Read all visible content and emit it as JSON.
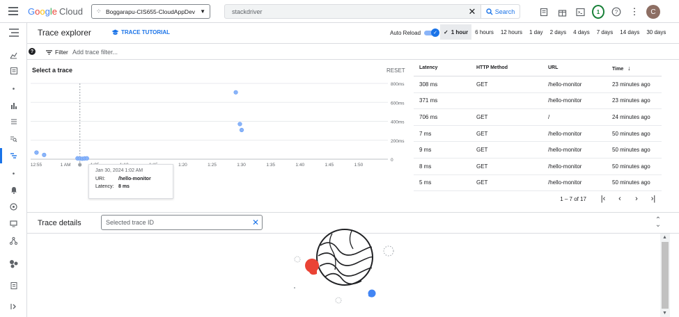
{
  "topbar": {
    "brand": [
      "G",
      "o",
      "o",
      "g",
      "l",
      "e"
    ],
    "brand_suffix": "Cloud",
    "project": "Boggarapu-CIS655-CloudAppDev",
    "search_value": "stackdriver",
    "search_button": "Search",
    "notifications_count": "1",
    "avatar_letter": "C"
  },
  "header": {
    "title": "Trace explorer",
    "tutorial": "TRACE TUTORIAL",
    "autoreload": "Auto Reload",
    "time_ranges": [
      "1 hour",
      "6 hours",
      "12 hours",
      "1 day",
      "2 days",
      "4 days",
      "7 days",
      "14 days",
      "30 days"
    ],
    "selected_range": "1 hour"
  },
  "filter": {
    "label": "Filter",
    "placeholder": "Add trace filter..."
  },
  "chart_panel": {
    "title": "Select a trace",
    "reset": "RESET"
  },
  "chart_data": {
    "type": "scatter",
    "title": "",
    "xlabel": "",
    "ylabel": "",
    "x_ticks": [
      "12:55",
      "1 AM",
      "1:05",
      "1:10",
      "1:15",
      "1:20",
      "1:25",
      "1:30",
      "1:35",
      "1:40",
      "1:45",
      "1:50"
    ],
    "y_ticks": [
      "0",
      "200ms",
      "400ms",
      "600ms",
      "800ms"
    ],
    "ylim": [
      0,
      800
    ],
    "xlim_minutes": [
      0,
      60
    ],
    "grid": true,
    "points": [
      {
        "x": 1.0,
        "y": 70
      },
      {
        "x": 2.3,
        "y": 45
      },
      {
        "x": 8.0,
        "y": 9
      },
      {
        "x": 8.4,
        "y": 7
      },
      {
        "x": 8.8,
        "y": 5
      },
      {
        "x": 9.2,
        "y": 8
      },
      {
        "x": 9.6,
        "y": 9
      },
      {
        "x": 35.0,
        "y": 706
      },
      {
        "x": 35.7,
        "y": 371
      },
      {
        "x": 36.0,
        "y": 308
      }
    ],
    "selected_x": 8.4
  },
  "tooltip": {
    "date": "Jan 30, 2024 1:02 AM",
    "uri_label": "URI:",
    "uri_value": "/hello-monitor",
    "latency_label": "Latency:",
    "latency_value": "8 ms"
  },
  "table": {
    "headers": [
      "Latency",
      "HTTP Method",
      "URL",
      "Time"
    ],
    "rows": [
      [
        "308 ms",
        "GET",
        "/hello-monitor",
        "23 minutes ago"
      ],
      [
        "371 ms",
        "",
        "/hello-monitor",
        "23 minutes ago"
      ],
      [
        "706 ms",
        "GET",
        "/",
        "24 minutes ago"
      ],
      [
        "7 ms",
        "GET",
        "/hello-monitor",
        "50 minutes ago"
      ],
      [
        "9 ms",
        "GET",
        "/hello-monitor",
        "50 minutes ago"
      ],
      [
        "8 ms",
        "GET",
        "/hello-monitor",
        "50 minutes ago"
      ],
      [
        "5 ms",
        "GET",
        "/hello-monitor",
        "50 minutes ago"
      ]
    ],
    "pager_text": "1 – 7 of 17"
  },
  "details": {
    "title": "Trace details",
    "trace_id_placeholder": "Selected trace ID"
  },
  "colors": {
    "accent": "#1a73e8",
    "point": "#8ab4f8",
    "selected_point": "#9aa0a6"
  }
}
